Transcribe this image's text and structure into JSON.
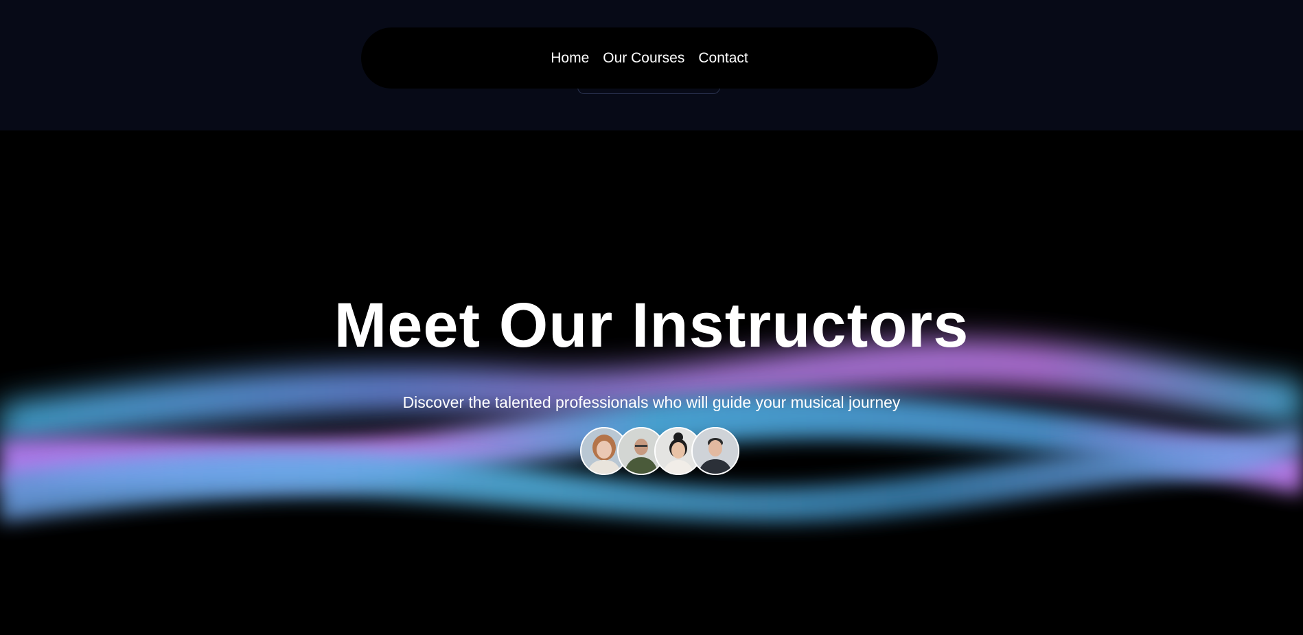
{
  "nav": {
    "items": [
      {
        "label": "Home"
      },
      {
        "label": "Our Courses"
      },
      {
        "label": "Contact"
      }
    ]
  },
  "hero": {
    "title": "Meet Our Instructors",
    "subtitle": "Discover the talented professionals who will guide your musical journey"
  },
  "instructors": {
    "avatars": [
      {
        "icon": "instructor-1-avatar",
        "bg": "#b9c7d3",
        "hair": "#b4744a",
        "skin": "#eac7b3",
        "shirt": "#e9e4dc"
      },
      {
        "icon": "instructor-2-avatar",
        "bg": "#d3d6d3",
        "hair": "#3b3b3b",
        "skin": "#c79a80",
        "shirt": "#4a5a3a"
      },
      {
        "icon": "instructor-3-avatar",
        "bg": "#e4e4e2",
        "hair": "#1d1d1d",
        "skin": "#e8c2a6",
        "shirt": "#f1ede8"
      },
      {
        "icon": "instructor-4-avatar",
        "bg": "#cfd3d8",
        "hair": "#2a2a2a",
        "skin": "#e2b9a0",
        "shirt": "#2b3038"
      }
    ]
  },
  "colors": {
    "top_band": "#070a17",
    "navbar": "#000000",
    "wave_violet": "#c27cf0",
    "wave_cyan": "#4fb6e8",
    "wave_blue": "#6a8fe8"
  }
}
